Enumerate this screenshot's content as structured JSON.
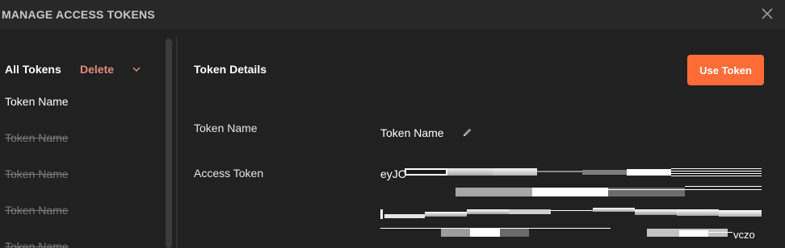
{
  "header": {
    "title": "MANAGE ACCESS TOKENS",
    "close_icon": "close-icon"
  },
  "sidebar": {
    "heading": "All Tokens",
    "delete_label": "Delete",
    "items": [
      {
        "label": "Token Name",
        "state": "active"
      },
      {
        "label": "Token Name",
        "state": "revoked"
      },
      {
        "label": "Token Name",
        "state": "revoked"
      },
      {
        "label": "Token Name",
        "state": "revoked"
      },
      {
        "label": "Token Name",
        "state": "revoked"
      }
    ]
  },
  "main": {
    "title": "Token Details",
    "use_token_label": "Use Token",
    "fields": {
      "name_label": "Token Name",
      "name_value": "Token Name",
      "access_label": "Access Token",
      "access_prefix": "eyJC",
      "access_suffix": "vczo"
    }
  },
  "colors": {
    "accent": "#ff6c37",
    "delete": "#e58a7a",
    "background": "#212121",
    "header_bg": "#282828"
  }
}
